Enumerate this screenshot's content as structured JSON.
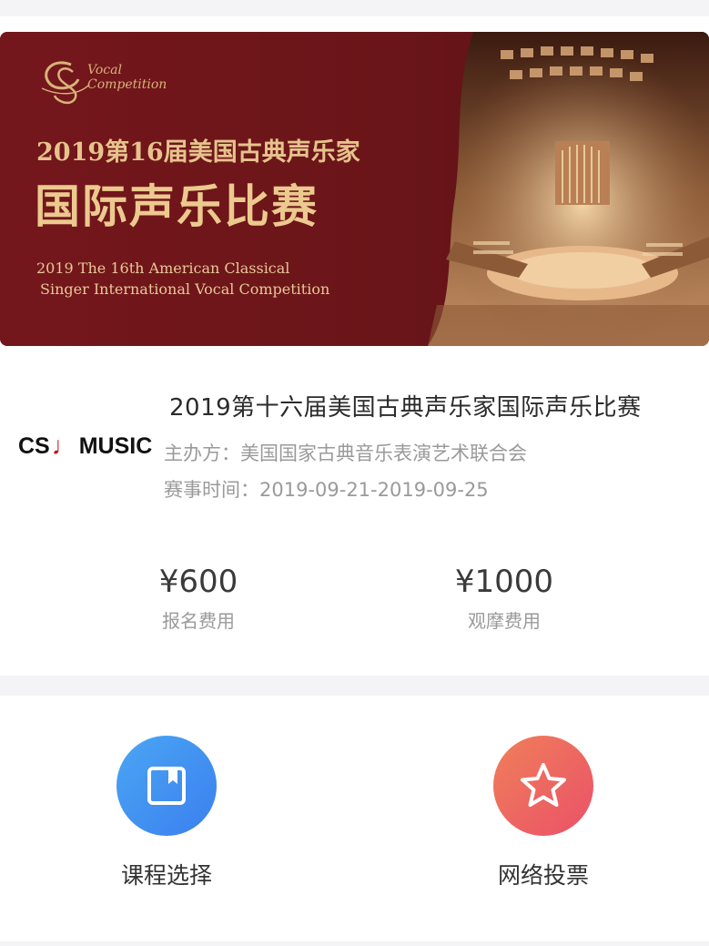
{
  "banner": {
    "logo_line1": "Vocal",
    "logo_line2": "Competition",
    "title_line1": "2019第16届美国古典声乐家",
    "title_line2": "国际声乐比赛",
    "english_line1": "2019 The 16th American Classical",
    "english_line2": "Singer International Vocal Competition"
  },
  "event": {
    "title": "2019第十六届美国古典声乐家国际声乐比赛",
    "brand_left": "CS",
    "brand_right": "MUSIC",
    "organizer": "主办方：美国国家古典音乐表演艺术联合会",
    "time": "赛事时间：2019-09-21-2019-09-25"
  },
  "prices": [
    {
      "amount": "¥600",
      "label": "报名费用"
    },
    {
      "amount": "¥1000",
      "label": "观摩费用"
    }
  ],
  "actions": [
    {
      "label": "课程选择",
      "icon": "bookmark-icon",
      "color": "#3f8ef1"
    },
    {
      "label": "网络投票",
      "icon": "star-icon",
      "color": "#ec6260"
    }
  ]
}
